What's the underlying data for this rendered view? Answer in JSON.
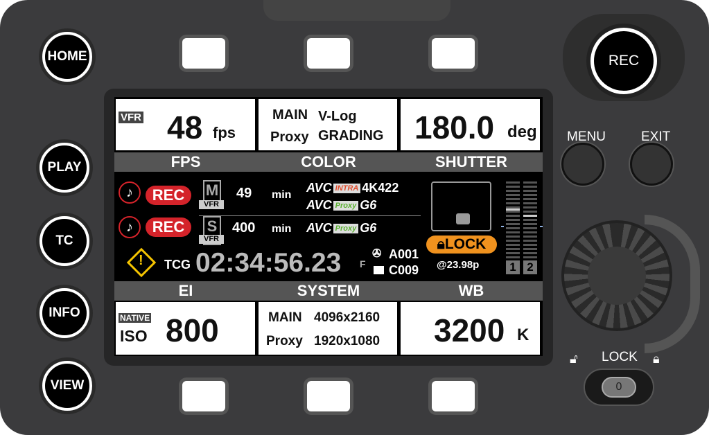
{
  "buttons": {
    "home": "HOME",
    "play": "PLAY",
    "tc": "TC",
    "info": "INFO",
    "view": "VIEW",
    "rec": "REC",
    "menu": "MENU",
    "exit": "EXIT",
    "lock": "LOCK"
  },
  "screen": {
    "fps": {
      "badge": "VFR",
      "value": "48",
      "unit": "fps",
      "label": "FPS"
    },
    "color": {
      "main_label": "MAIN",
      "main_value": "V-Log",
      "proxy_label": "Proxy",
      "proxy_value": "GRADING",
      "label": "COLOR"
    },
    "shutter": {
      "value": "180.0",
      "unit": "deg",
      "label": "SHUTTER"
    },
    "slot1": {
      "rec": "REC",
      "card": "M",
      "card_mode": "VFR",
      "remaining": "49",
      "unit": "min",
      "codec_main": "AVC",
      "codec_main_tag": "INTRA",
      "codec_main_format": "4K422",
      "codec_proxy": "AVC",
      "codec_proxy_tag": "Proxy",
      "codec_proxy_format": "G6"
    },
    "slot2": {
      "rec": "REC",
      "card": "S",
      "card_mode": "VFR",
      "remaining": "400",
      "unit": "min",
      "codec_proxy": "AVC",
      "codec_proxy_tag": "Proxy",
      "codec_proxy_format": "G6"
    },
    "timecode": {
      "mode": "TCG",
      "value": "02:34:56.23",
      "flag": "F"
    },
    "reel": "A001",
    "clip": "C009",
    "genlock": {
      "label": "LOCK",
      "rate": "@23.98p"
    },
    "audio_meters": {
      "channels": [
        "1",
        "2"
      ],
      "level_ch1": 0.7,
      "level_ch2": 0.62
    },
    "ei": {
      "badge": "NATIVE",
      "unit": "ISO",
      "value": "800",
      "label": "EI"
    },
    "system": {
      "main_label": "MAIN",
      "main_value": "4096x2160",
      "proxy_label": "Proxy",
      "proxy_value": "1920x1080",
      "label": "SYSTEM"
    },
    "wb": {
      "value": "3200",
      "unit": "K",
      "label": "WB"
    }
  },
  "colors": {
    "rec_red": "#d4232a",
    "lock_orange": "#f0921e",
    "warning_yellow": "#f5c400",
    "proxy_green": "#5ab031"
  }
}
